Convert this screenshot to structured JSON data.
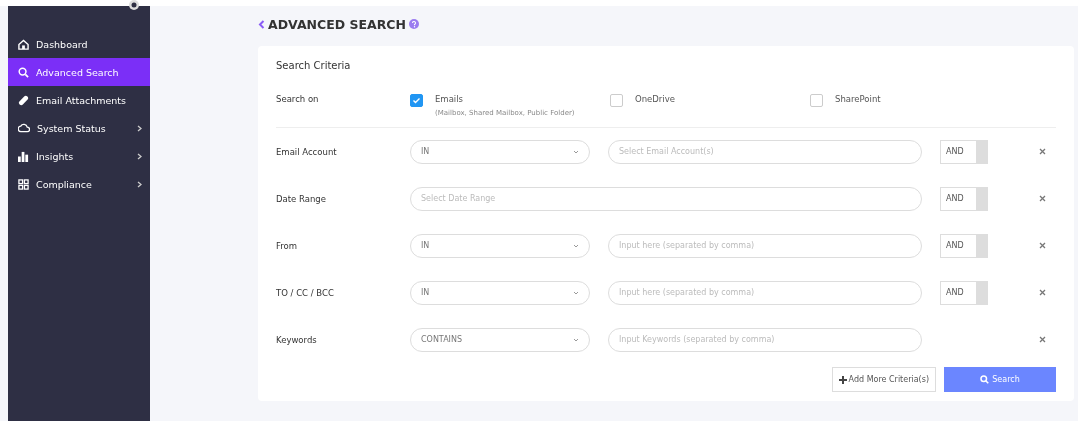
{
  "sidebar": {
    "items": [
      {
        "label": "Dashboard",
        "selected": false,
        "expandable": false
      },
      {
        "label": "Advanced Search",
        "selected": true,
        "expandable": false
      },
      {
        "label": "Email Attachments",
        "selected": false,
        "expandable": false
      },
      {
        "label": "System Status",
        "selected": false,
        "expandable": true
      },
      {
        "label": "Insights",
        "selected": false,
        "expandable": true
      },
      {
        "label": "Compliance",
        "selected": false,
        "expandable": true
      }
    ]
  },
  "page": {
    "title": "ADVANCED SEARCH"
  },
  "card": {
    "title": "Search Criteria",
    "search_on": {
      "label": "Search on",
      "options": [
        {
          "label": "Emails",
          "note": "(Mailbox, Shared Mailbox, Public Folder)",
          "checked": true
        },
        {
          "label": "OneDrive",
          "checked": false
        },
        {
          "label": "SharePoint",
          "checked": false
        }
      ]
    },
    "criteria": [
      {
        "label": "Email Account",
        "operator": "IN",
        "placeholder": "Select Email Account(s)",
        "connector": "AND"
      },
      {
        "label": "Date Range",
        "placeholder": "Select Date Range",
        "connector": "AND"
      },
      {
        "label": "From",
        "operator": "IN",
        "placeholder": "Input here (separated by comma)",
        "connector": "AND"
      },
      {
        "label": "TO / CC / BCC",
        "operator": "IN",
        "placeholder": "Input here (separated by comma)",
        "connector": "AND"
      },
      {
        "label": "Keywords",
        "operator": "CONTAINS",
        "placeholder": "Input Keywords (separated by comma)"
      }
    ],
    "add_button": "Add More Criteria(s)",
    "search_button": "Search"
  }
}
